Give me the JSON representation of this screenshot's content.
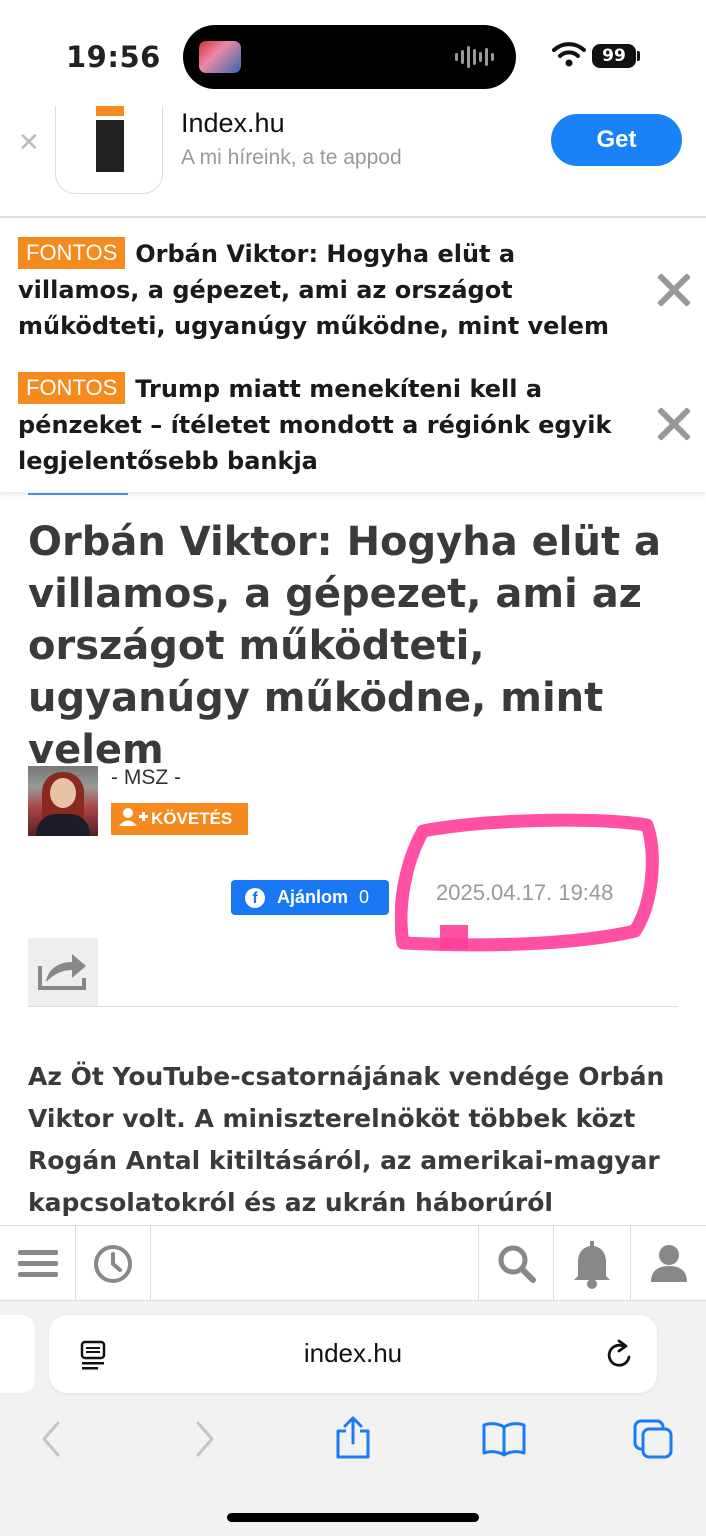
{
  "status_bar": {
    "time": "19:56",
    "battery": "99"
  },
  "app_banner": {
    "title": "Index.hu",
    "subtitle": "A mi híreink, a te appod",
    "get_label": "Get"
  },
  "breaking_news": [
    {
      "badge": "FONTOS",
      "text": "Orbán Viktor: Hogyha elüt a villamos, a gépezet, ami az országot működteti, ugyanúgy működne, mint velem"
    },
    {
      "badge": "FONTOS",
      "text": "Trump miatt menekíteni kell a pénzeket – ítéletet mondott a régiónk egyik legjelentősebb bankja"
    }
  ],
  "article": {
    "title": "Orbán Viktor: Hogyha elüt a villamos, a gépezet, ami az országot működteti, ugyanúgy működne, mint velem",
    "author": "- MSZ -",
    "follow_label": "KÖVETÉS",
    "fb_label": "Ajánlom",
    "fb_count": "0",
    "date": "2025.04.17. 19:48",
    "lead": "Az Öt YouTube-csatornájának vendége Orbán Viktor volt. A miniszterelnököt többek közt Rogán Antal kitiltásáról, az amerikai-magyar kapcsolatokról és az ukrán háborúról"
  },
  "safari": {
    "url": "index.hu"
  },
  "colors": {
    "accent_orange": "#f58a1f",
    "get_blue": "#1a82f7",
    "facebook_blue": "#1877f2",
    "highlight_pink": "#ff3d9a"
  },
  "icons": [
    "menu-icon",
    "history-clock-icon",
    "search-icon",
    "bell-icon",
    "user-icon",
    "share-icon",
    "reader-icon",
    "reload-icon",
    "back-icon",
    "forward-icon",
    "safari-share-icon",
    "bookmarks-icon",
    "tabs-icon"
  ]
}
